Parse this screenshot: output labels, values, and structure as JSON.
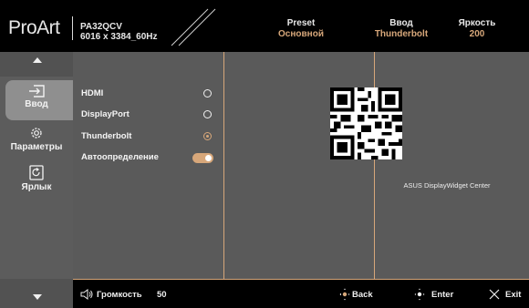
{
  "header": {
    "logo": "ProArt",
    "model_line1": "PA32QCV",
    "model_line2": "6016 x 3384_60Hz",
    "status": [
      {
        "label": "Preset",
        "value": "Основной"
      },
      {
        "label": "Ввод",
        "value": "Thunderbolt"
      },
      {
        "label": "Яркость",
        "value": "200"
      }
    ]
  },
  "sidebar": {
    "items": [
      {
        "label": "Ввод",
        "icon": "input-icon",
        "selected": true
      },
      {
        "label": "Параметры",
        "icon": "gear-icon",
        "selected": false
      },
      {
        "label": "Ярлык",
        "icon": "shortcut-icon",
        "selected": false
      }
    ]
  },
  "input_options": [
    {
      "label": "HDMI",
      "control": "radio",
      "selected": false
    },
    {
      "label": "DisplayPort",
      "control": "radio",
      "selected": false
    },
    {
      "label": "Thunderbolt",
      "control": "radio",
      "selected": true
    },
    {
      "label": "Автоопределение",
      "control": "toggle",
      "on": true
    }
  ],
  "qr_caption": "ASUS DisplayWidget Center",
  "footer": {
    "volume_label": "Громкость",
    "volume_value": "50",
    "back_label": "Back",
    "enter_label": "Enter",
    "exit_label": "Exit"
  },
  "colors": {
    "accent": "#d7a77a",
    "sidebar": "#525252",
    "panel": "#5a5a5a",
    "selected": "#8f8f8f"
  }
}
